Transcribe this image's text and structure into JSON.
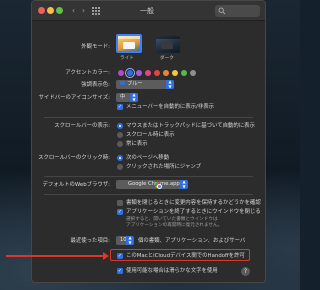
{
  "window": {
    "title": "一般"
  },
  "appearance": {
    "label": "外観モード:",
    "options": [
      {
        "name": "ライト",
        "selected": true
      },
      {
        "name": "ダーク",
        "selected": false
      }
    ]
  },
  "accent": {
    "label": "アクセントカラー:",
    "colors": [
      "#b34ac9",
      "#2f6fe0",
      "#a55bd6",
      "#e2487f",
      "#e2463c",
      "#e9853a",
      "#f0c73c",
      "#5bb94c",
      "#8e8e93"
    ],
    "selected_index": 1
  },
  "highlight": {
    "label": "強調表示色:",
    "value": "ブルー"
  },
  "sidebar_icon": {
    "label": "サイドバーのアイコンサイズ:",
    "value": "中"
  },
  "menubar": {
    "label": "メニューバーを自動的に表示/非表示",
    "checked": true
  },
  "scrollbar": {
    "label": "スクロールバーの表示:",
    "options": [
      {
        "text": "マウスまたはトラックパッドに基づいて自動的に表示",
        "selected": true
      },
      {
        "text": "スクロール時に表示",
        "selected": false
      },
      {
        "text": "常に表示",
        "selected": false
      }
    ]
  },
  "scroll_click": {
    "label": "スクロールバーのクリック時:",
    "options": [
      {
        "text": "次のページへ移動",
        "selected": true
      },
      {
        "text": "クリックされた場所にジャンプ",
        "selected": false
      }
    ]
  },
  "browser": {
    "label": "デフォルトのWebブラウザ:",
    "value": "Google Chrome.app"
  },
  "documents": {
    "ask_keep": {
      "text": "書類を閉じるときに変更内容を保持するかどうかを確認",
      "checked": false
    },
    "close_windows": {
      "text": "アプリケーションを終了するときにウインドウを閉じる",
      "checked": true
    },
    "note_lines": [
      "選択すると、開いていた書類とウインドウは",
      "アプリケーションの再開時に復元されません。"
    ]
  },
  "recent": {
    "label": "最近使った項目:",
    "value": "10",
    "text": "個の書類、アプリケーション、およびサーバ"
  },
  "handoff": {
    "text": "このMacとiCloudデバイス間でのHandoffを許可",
    "checked": true
  },
  "lcd": {
    "text": "使用可能な場合は滑らかな文字を使用",
    "checked": true
  },
  "help": {
    "label": "?"
  }
}
